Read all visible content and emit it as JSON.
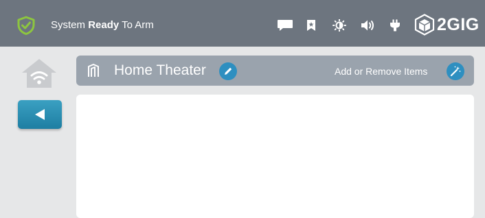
{
  "status": {
    "prefix": "System ",
    "emphasis": "Ready",
    "suffix": " To Arm",
    "icon": "shield-check-icon",
    "icon_color": "#8dc63f"
  },
  "toolbar": {
    "icons": [
      "message-icon",
      "bookmark-icon",
      "brightness-icon",
      "volume-icon",
      "power-plug-icon"
    ]
  },
  "brand": {
    "name": "2GIG"
  },
  "sidebar": {
    "home_icon": "home-wifi-icon",
    "back_icon": "back-arrow-icon"
  },
  "room": {
    "title": "Home Theater",
    "add_remove_label": "Add or Remove Items"
  },
  "colors": {
    "topbar": "#6d757f",
    "background": "#e6e7e8",
    "header": "#9aa3ad",
    "accent": "#2e8fc0"
  }
}
